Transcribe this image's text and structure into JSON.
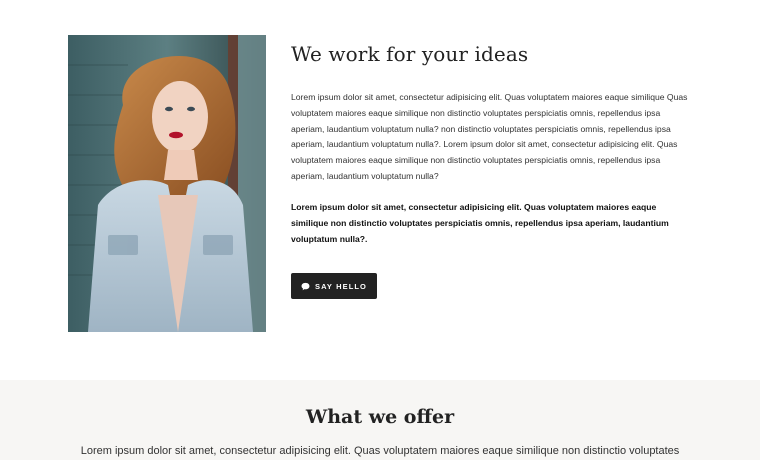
{
  "about": {
    "heading": "We work for your ideas",
    "paragraph": "Lorem ipsum dolor sit amet, consectetur adipisicing elit. Quas voluptatem maiores eaque similique Quas voluptatem maiores eaque similique non distinctio voluptates perspiciatis omnis, repellendus ipsa aperiam, laudantium voluptatum nulla? non distinctio voluptates perspiciatis omnis, repellendus ipsa aperiam, laudantium voluptatum nulla?. Lorem ipsum dolor sit amet, consectetur adipisicing elit. Quas voluptatem maiores eaque similique non distinctio voluptates perspiciatis omnis, repellendus ipsa aperiam, laudantium voluptatum nulla?",
    "paragraph_bold": "Lorem ipsum dolor sit amet, consectetur adipisicing elit. Quas voluptatem maiores eaque similique non distinctio voluptates perspiciatis omnis, repellendus ipsa aperiam, laudantium voluptatum nulla?.",
    "button_label": "SAY HELLO",
    "button_icon": "chat-bubble-icon"
  },
  "offer": {
    "title": "What we offer",
    "text": "Lorem ipsum dolor sit amet, consectetur adipisicing elit. Quas voluptatem maiores eaque similique non distinctio voluptates"
  },
  "colors": {
    "button_bg": "#222222",
    "offer_bg": "#f7f6f4"
  }
}
